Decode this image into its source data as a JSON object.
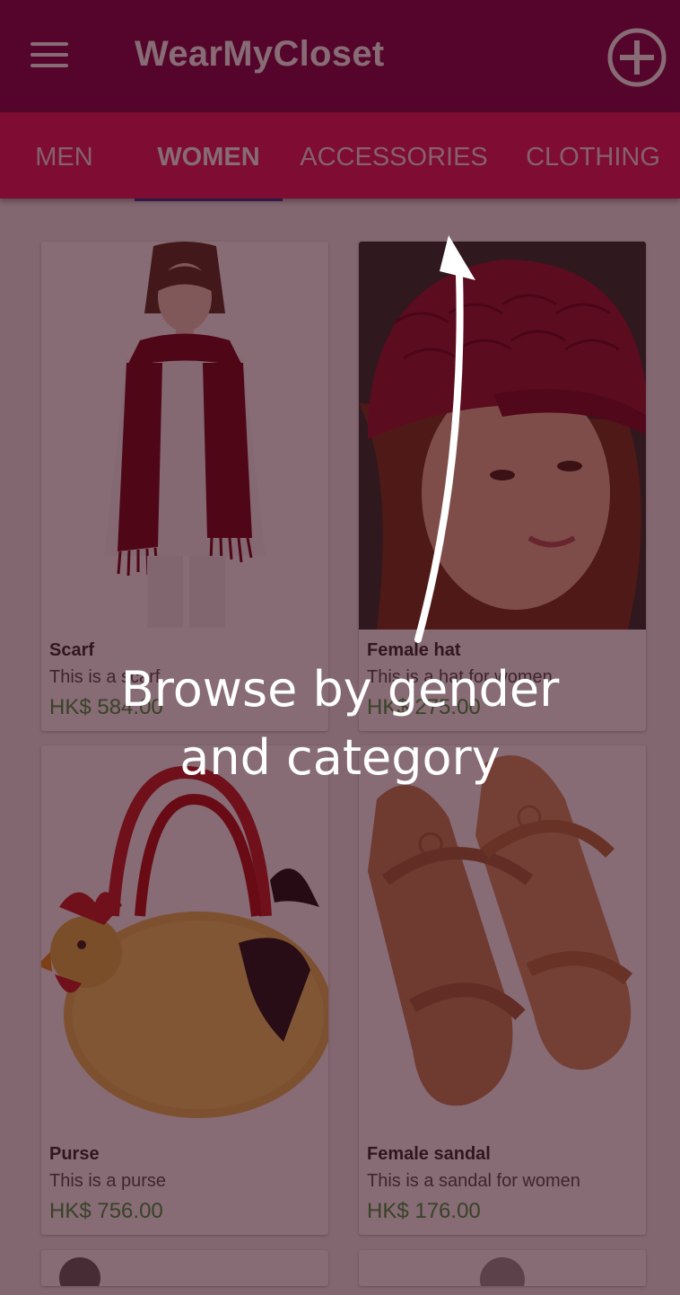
{
  "app": {
    "title": "WearMyCloset"
  },
  "tabs": [
    {
      "label": "MEN",
      "active": false
    },
    {
      "label": "WOMEN",
      "active": true
    },
    {
      "label": "ACCESSORIES",
      "active": false
    },
    {
      "label": "CLOTHING",
      "active": false
    }
  ],
  "products": [
    {
      "name": "Scarf",
      "description": "This is a scarf",
      "price": "HK$ 584.00",
      "image": "scarf-photo"
    },
    {
      "name": "Female hat",
      "description": "This is a hat for women",
      "price": "HK$ 275.00",
      "image": "hat-photo"
    },
    {
      "name": "Purse",
      "description": "This is a purse",
      "price": "HK$ 756.00",
      "image": "purse-photo"
    },
    {
      "name": "Female sandal",
      "description": "This is a sandal for women",
      "price": "HK$ 176.00",
      "image": "sandal-photo"
    }
  ],
  "coachmark": {
    "line1": "Browse by gender",
    "line2": "and category"
  },
  "colors": {
    "primary_dark": "#880e4f",
    "tab_bar": "#e91e63",
    "tab_indicator": "#3f51b5",
    "price": "#43a047"
  },
  "icons": {
    "menu": "menu-icon",
    "add": "add-circle-icon"
  }
}
